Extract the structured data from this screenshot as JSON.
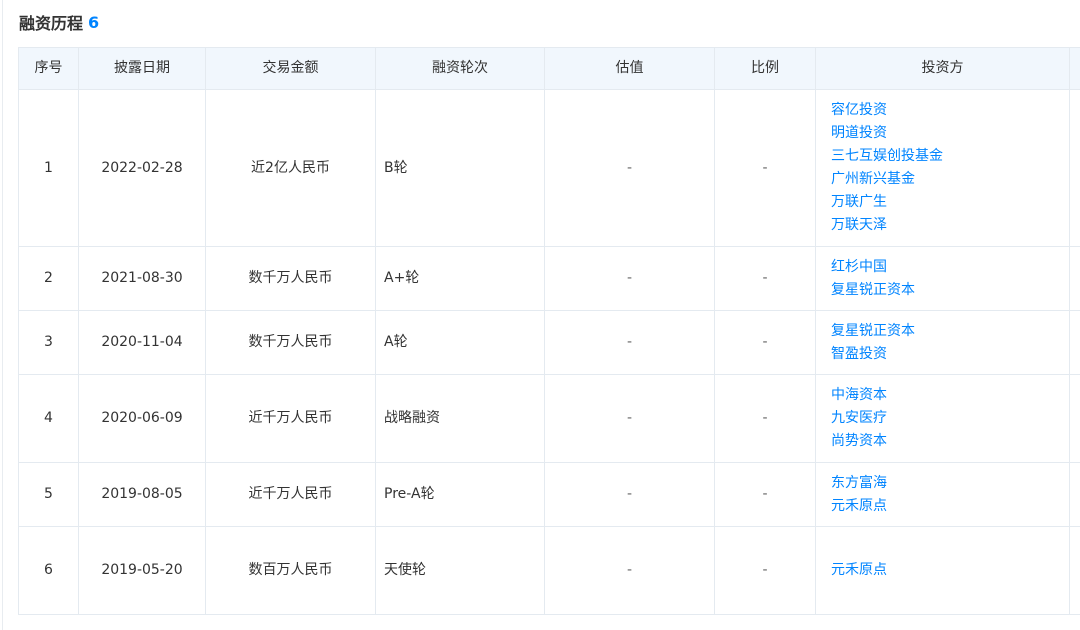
{
  "section": {
    "title": "融资历程",
    "count": "6"
  },
  "table": {
    "headers": [
      "序号",
      "披露日期",
      "交易金额",
      "融资轮次",
      "估值",
      "比例",
      "投资方"
    ],
    "rows": [
      {
        "index": "1",
        "date": "2022-02-28",
        "amount": "近2亿人民币",
        "round": "B轮",
        "valuation": "-",
        "ratio": "-",
        "investors": [
          "容亿投资",
          "明道投资",
          "三七互娱创投基金",
          "广州新兴基金",
          "万联广生",
          "万联天泽"
        ]
      },
      {
        "index": "2",
        "date": "2021-08-30",
        "amount": "数千万人民币",
        "round": "A+轮",
        "valuation": "-",
        "ratio": "-",
        "investors": [
          "红杉中国",
          "复星锐正资本"
        ]
      },
      {
        "index": "3",
        "date": "2020-11-04",
        "amount": "数千万人民币",
        "round": "A轮",
        "valuation": "-",
        "ratio": "-",
        "investors": [
          "复星锐正资本",
          "智盈投资"
        ]
      },
      {
        "index": "4",
        "date": "2020-06-09",
        "amount": "近千万人民币",
        "round": "战略融资",
        "valuation": "-",
        "ratio": "-",
        "investors": [
          "中海资本",
          "九安医疗",
          "尚势资本"
        ]
      },
      {
        "index": "5",
        "date": "2019-08-05",
        "amount": "近千万人民币",
        "round": "Pre-A轮",
        "valuation": "-",
        "ratio": "-",
        "investors": [
          "东方富海",
          "元禾原点"
        ]
      },
      {
        "index": "6",
        "date": "2019-05-20",
        "amount": "数百万人民币",
        "round": "天使轮",
        "valuation": "-",
        "ratio": "-",
        "investors": [
          "元禾原点"
        ]
      }
    ]
  },
  "colors": {
    "accent": "#0084ff",
    "header_bg": "#f1f7fd",
    "border": "#e4eaf0",
    "text": "#333333"
  }
}
